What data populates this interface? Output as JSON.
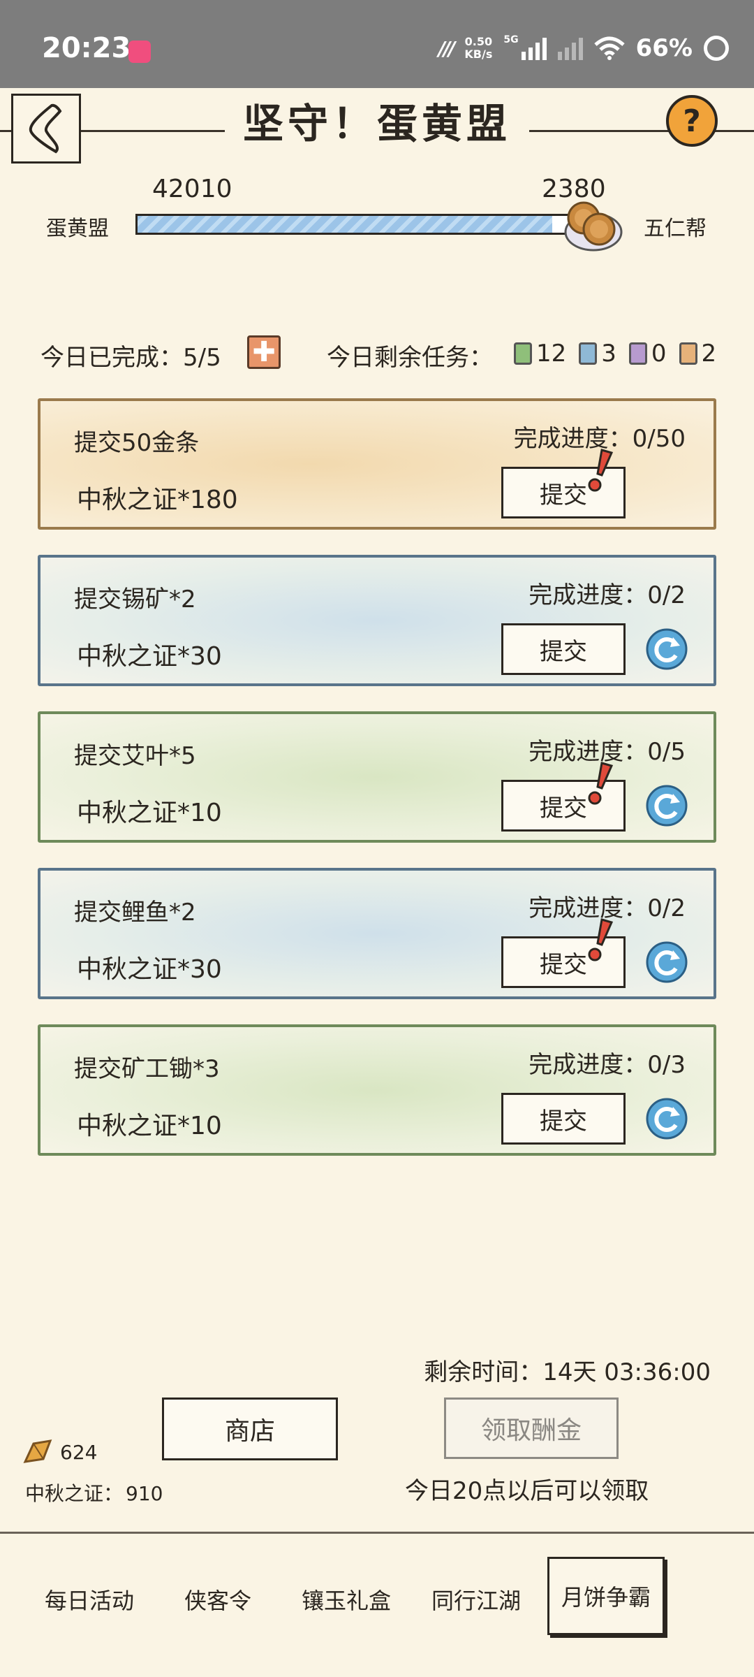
{
  "status_bar": {
    "time": "20:23",
    "net_speed": "0.50\nKB/s",
    "net_speed_value": "0.50",
    "net_speed_unit": "KB/s",
    "network": "5G",
    "battery": "66%"
  },
  "header": {
    "title": "坚守！蛋黄盟",
    "back_icon": "back-chevron-icon",
    "help_icon": "question-icon"
  },
  "versus": {
    "left_team": "蛋黄盟",
    "left_score": "42010",
    "right_team": "五仁帮",
    "right_score": "2380",
    "left_share": 0.946
  },
  "summary": {
    "done_label": "今日已完成：5/5",
    "remaining_label": "今日剩余任务：",
    "chips": [
      {
        "count": "12",
        "color": "#8fbf7a"
      },
      {
        "count": "3",
        "color": "#8fb9d6"
      },
      {
        "count": "0",
        "color": "#b79bcf"
      },
      {
        "count": "2",
        "color": "#e6b27a"
      }
    ]
  },
  "tasks": [
    {
      "title": "提交50金条",
      "reward": "中秋之证*180",
      "progress": "完成进度：0/50",
      "button": "提交",
      "alert": true,
      "refresh": false,
      "style": "gold"
    },
    {
      "title": "提交锡矿*2",
      "reward": "中秋之证*30",
      "progress": "完成进度：0/2",
      "button": "提交",
      "alert": false,
      "refresh": true,
      "style": "blue"
    },
    {
      "title": "提交艾叶*5",
      "reward": "中秋之证*10",
      "progress": "完成进度：0/5",
      "button": "提交",
      "alert": true,
      "refresh": true,
      "style": "green"
    },
    {
      "title": "提交鲤鱼*2",
      "reward": "中秋之证*30",
      "progress": "完成进度：0/2",
      "button": "提交",
      "alert": true,
      "refresh": true,
      "style": "blue"
    },
    {
      "title": "提交矿工锄*3",
      "reward": "中秋之证*10",
      "progress": "完成进度：0/3",
      "button": "提交",
      "alert": false,
      "refresh": true,
      "style": "green"
    }
  ],
  "footer": {
    "time_left": "剩余时间：14天 03:36:00",
    "shop_button": "商店",
    "claim_button": "领取酬金",
    "claim_note": "今日20点以后可以领取",
    "gold_count": "624",
    "cert_label": "中秋之证：",
    "cert_count": "910"
  },
  "tabs": [
    {
      "label": "每日活动",
      "active": false
    },
    {
      "label": "侠客令",
      "active": false
    },
    {
      "label": "镶玉礼盒",
      "active": false
    },
    {
      "label": "同行江湖",
      "active": false
    },
    {
      "label": "月饼争霸",
      "active": true
    }
  ]
}
